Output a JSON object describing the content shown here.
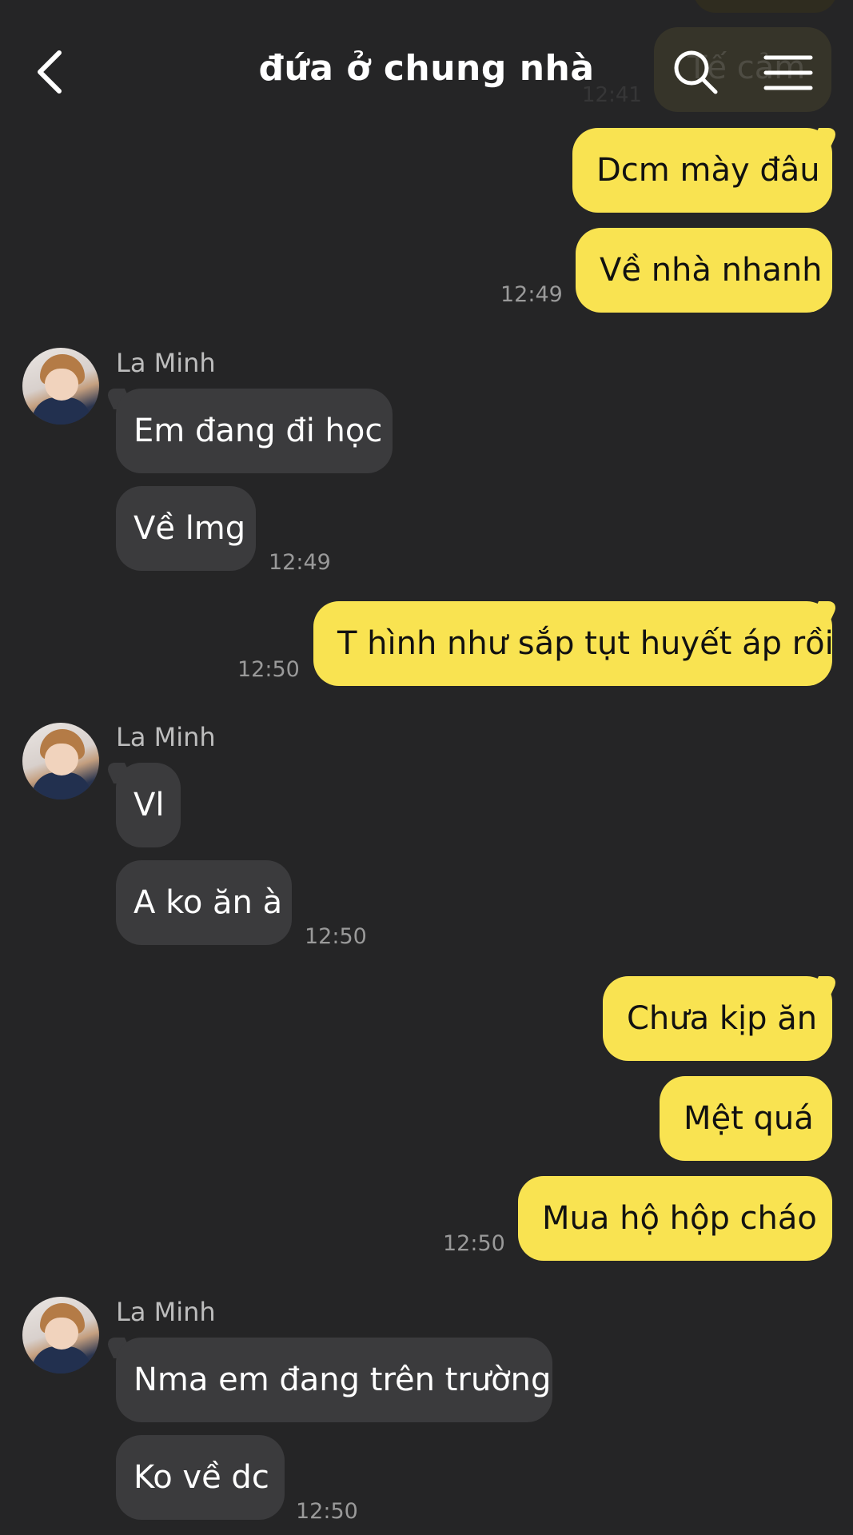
{
  "header": {
    "title": "đứa ở chung nhà",
    "ghost_text": "Tế cảm",
    "ghost_time": "12:41"
  },
  "messages": [
    {
      "side": "sent",
      "text": "Dcm mày đâu"
    },
    {
      "side": "sent",
      "text": "Về nhà nhanh",
      "time": "12:49"
    },
    {
      "side": "recv",
      "sender": "La Minh",
      "text": "Em đang đi học"
    },
    {
      "side": "recv",
      "text": "Về lmg",
      "time": "12:49"
    },
    {
      "side": "sent",
      "text": "T hình như sắp tụt huyết áp rồi",
      "time": "12:50"
    },
    {
      "side": "recv",
      "sender": "La Minh",
      "text": "Vl"
    },
    {
      "side": "recv",
      "text": "A ko ăn à",
      "time": "12:50"
    },
    {
      "side": "sent",
      "text": "Chưa kịp ăn"
    },
    {
      "side": "sent",
      "text": "Mệt quá"
    },
    {
      "side": "sent",
      "text": "Mua hộ hộp cháo",
      "time": "12:50"
    },
    {
      "side": "recv",
      "sender": "La Minh",
      "text": "Nma em đang trên trường"
    },
    {
      "side": "recv",
      "text": "Ko về dc",
      "time": "12:50"
    }
  ],
  "colors": {
    "background": "#252526",
    "sent_bubble": "#f9e351",
    "received_bubble": "#3b3b3d"
  },
  "icons": [
    "back-arrow-icon",
    "search-icon",
    "menu-icon",
    "avatar-icon"
  ]
}
